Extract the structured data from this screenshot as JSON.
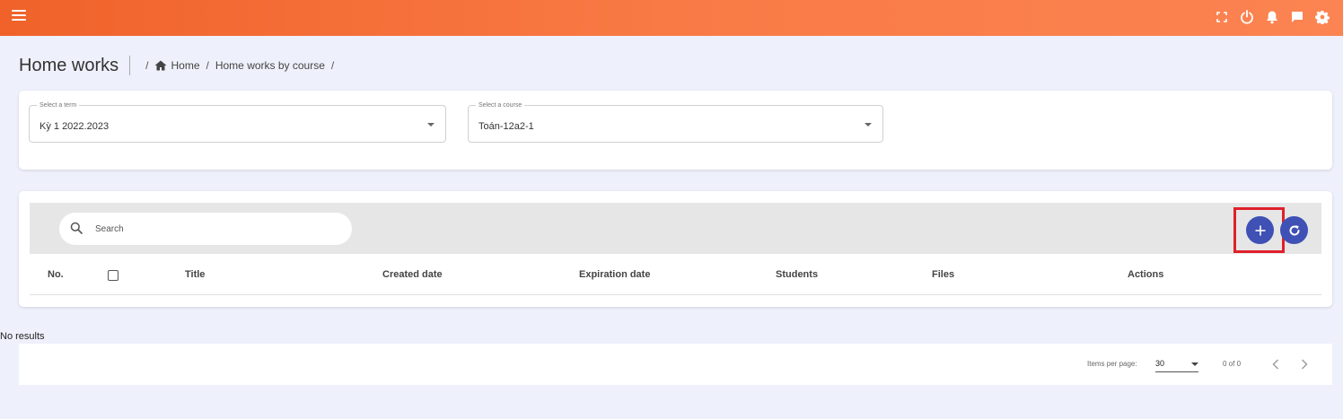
{
  "header": {
    "icons": [
      "menu-icon",
      "fullscreen-icon",
      "power-icon",
      "bell-icon",
      "chat-icon",
      "gear-icon"
    ]
  },
  "page": {
    "title": "Home works",
    "breadcrumb": {
      "sep": "/",
      "home": "Home",
      "current": "Home works by course"
    }
  },
  "filters": {
    "term": {
      "label": "Select a term",
      "value": "Kỳ 1 2022.2023"
    },
    "course": {
      "label": "Select a course",
      "value": "Toán-12a2-1"
    }
  },
  "table": {
    "search_placeholder": "Search",
    "accent_color": "#3f51b5",
    "highlight_color": "#e0202a",
    "columns": {
      "no": "No.",
      "title": "Title",
      "created": "Created date",
      "expiration": "Expiration date",
      "students": "Students",
      "files": "Files",
      "actions": "Actions"
    },
    "empty_text": "No results"
  },
  "paginator": {
    "items_per_page_label": "Items per page:",
    "page_size": "30",
    "range": "0 of 0"
  },
  "colors": {
    "header_start": "#f0622a",
    "header_end": "#fb8452",
    "background": "#eef0fb"
  }
}
